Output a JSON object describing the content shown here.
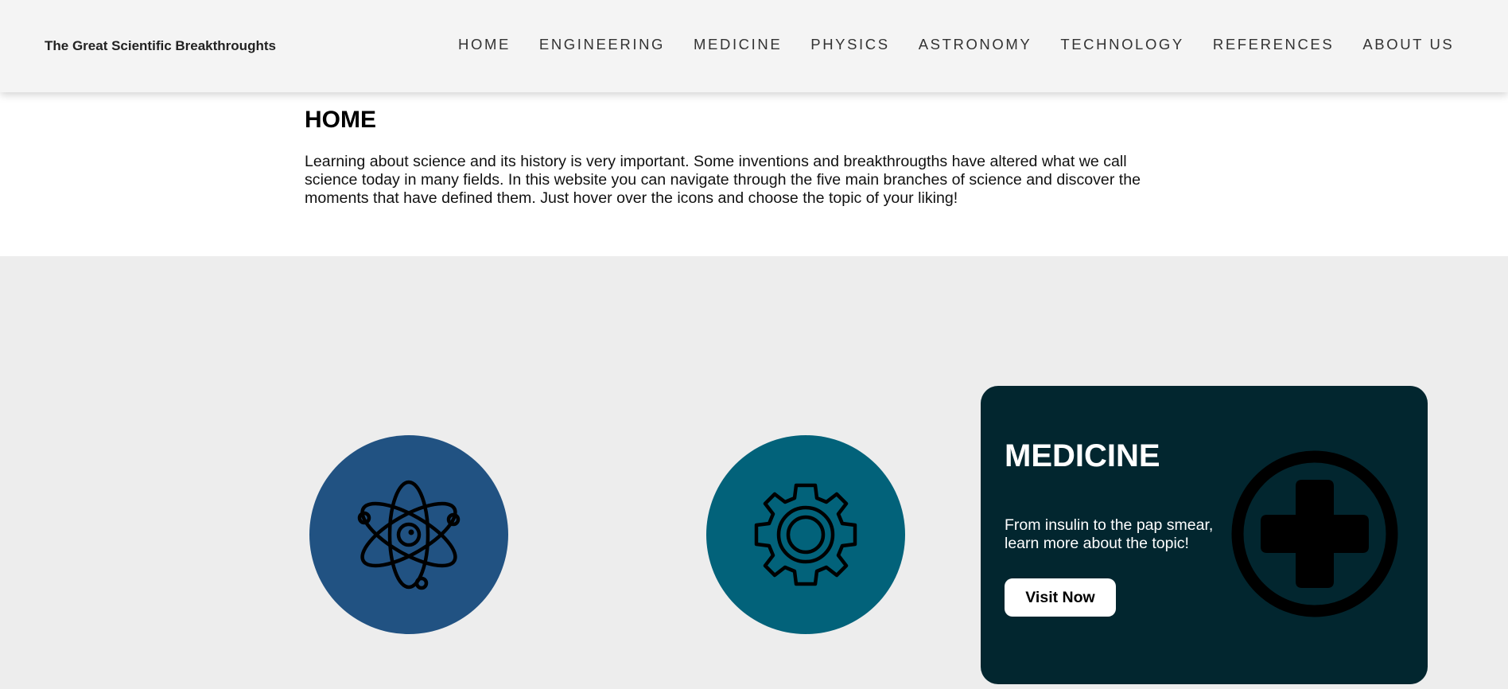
{
  "header": {
    "brand": "The Great Scientific Breakthroughts",
    "nav": [
      {
        "label": "HOME"
      },
      {
        "label": "ENGINEERING"
      },
      {
        "label": "MEDICINE"
      },
      {
        "label": "PHYSICS"
      },
      {
        "label": "ASTRONOMY"
      },
      {
        "label": "TECHNOLOGY"
      },
      {
        "label": "REFERENCES"
      },
      {
        "label": "ABOUT US"
      }
    ]
  },
  "intro": {
    "title": "HOME",
    "text": "Learning about science and its history is very important. Some inventions and breakthrougths have altered what we call science today in many fields. In this website you can navigate through the five main branches of science and discover the moments that have defined them. Just hover over the icons and choose the topic of your liking!"
  },
  "topics": {
    "physics": {
      "icon": "atom-icon",
      "color": "#215282"
    },
    "engineering": {
      "icon": "gear-icon",
      "color": "#02627a"
    },
    "medicine": {
      "title": "MEDICINE",
      "description": "From insulin to the pap smear, learn more about the topic!",
      "button_label": "Visit Now",
      "icon": "medical-cross-icon",
      "color": "#02262f"
    }
  }
}
